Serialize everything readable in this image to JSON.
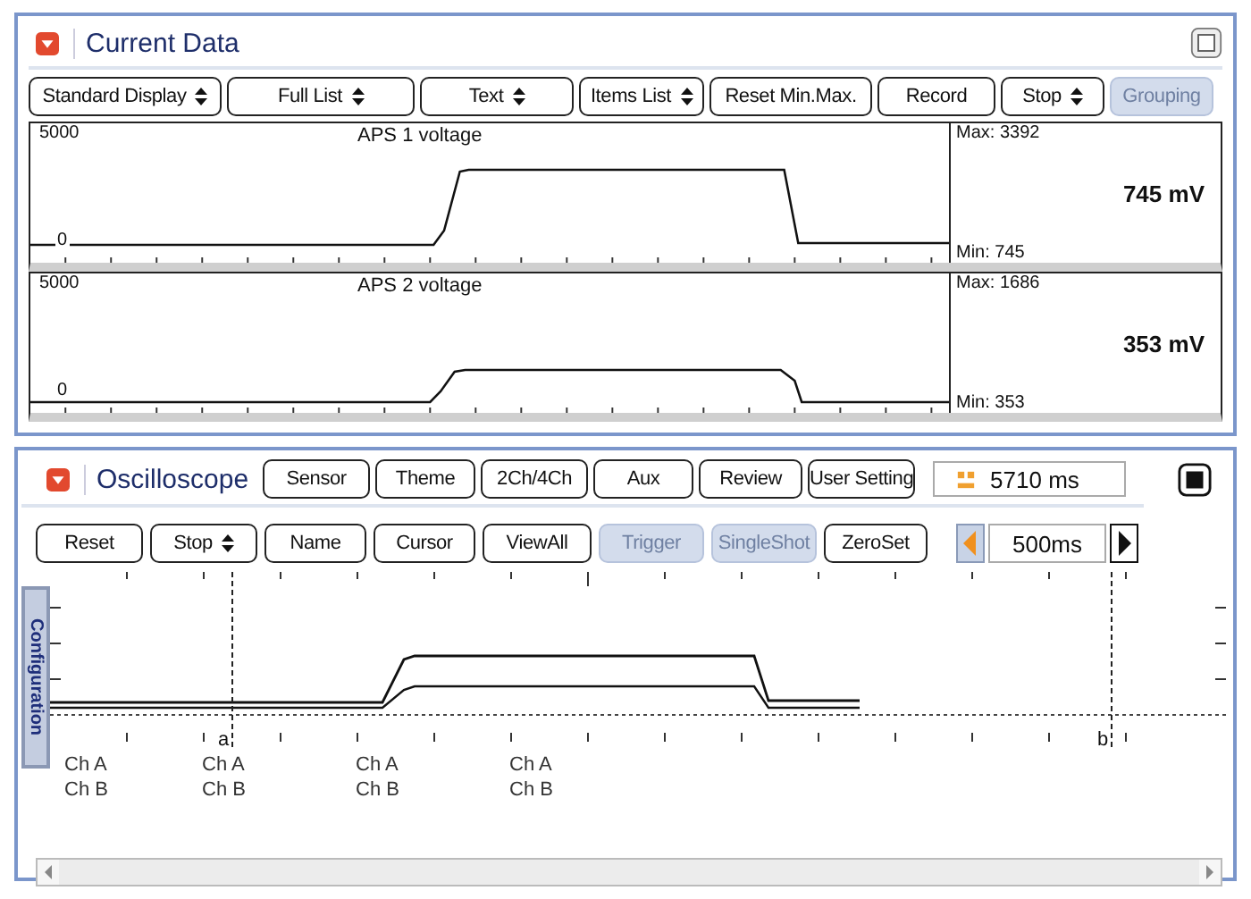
{
  "current_data": {
    "title": "Current Data",
    "toolbar": [
      {
        "label": "Standard Display",
        "kind": "dropdown",
        "disabled": false
      },
      {
        "label": "Full List",
        "kind": "dropdown",
        "disabled": false
      },
      {
        "label": "Text",
        "kind": "dropdown",
        "disabled": false
      },
      {
        "label": "Items List",
        "kind": "dropdown",
        "disabled": false
      },
      {
        "label": "Reset Min.Max.",
        "kind": "button",
        "disabled": false
      },
      {
        "label": "Record",
        "kind": "button",
        "disabled": false
      },
      {
        "label": "Stop",
        "kind": "dropdown",
        "disabled": false
      },
      {
        "label": "Grouping",
        "kind": "button",
        "disabled": true
      }
    ],
    "graphs": [
      {
        "title": "APS 1 voltage",
        "y_max": "5000",
        "y_min": "0",
        "max": "Max: 3392",
        "value": "745 mV",
        "min": "Min:  745"
      },
      {
        "title": "APS 2 voltage",
        "y_max": "5000",
        "y_min": "0",
        "max": "Max: 1686",
        "value": "353 mV",
        "min": "Min:  353"
      }
    ]
  },
  "oscilloscope": {
    "title": "Oscilloscope",
    "header_buttons": [
      {
        "label": "Sensor",
        "disabled": false
      },
      {
        "label": "Theme",
        "disabled": false
      },
      {
        "label": "2Ch/4Ch",
        "disabled": false
      },
      {
        "label": "Aux",
        "disabled": false
      },
      {
        "label": "Review",
        "disabled": false
      },
      {
        "label": "User Setting",
        "disabled": false
      }
    ],
    "time_display": "5710 ms",
    "toolbar": [
      {
        "label": "Reset",
        "kind": "button",
        "disabled": false
      },
      {
        "label": "Stop",
        "kind": "dropdown",
        "disabled": false
      },
      {
        "label": "Name",
        "kind": "button",
        "disabled": false
      },
      {
        "label": "Cursor",
        "kind": "button",
        "disabled": false
      },
      {
        "label": "ViewAll",
        "kind": "button",
        "disabled": false
      },
      {
        "label": "Trigger",
        "kind": "button",
        "disabled": true
      },
      {
        "label": "SingleShot",
        "kind": "button",
        "disabled": true
      },
      {
        "label": "ZeroSet",
        "kind": "button",
        "disabled": false
      }
    ],
    "timebase": "500ms",
    "side_tab": "Configuration",
    "cursors": [
      {
        "label": "a"
      },
      {
        "label": "b"
      }
    ],
    "channel_labels": [
      {
        "lines": [
          "Ch A",
          "Ch B"
        ]
      },
      {
        "lines": [
          "Ch A",
          "Ch B"
        ]
      },
      {
        "lines": [
          "Ch A",
          "Ch B"
        ]
      },
      {
        "lines": [
          "Ch A",
          "Ch B"
        ]
      }
    ]
  }
}
